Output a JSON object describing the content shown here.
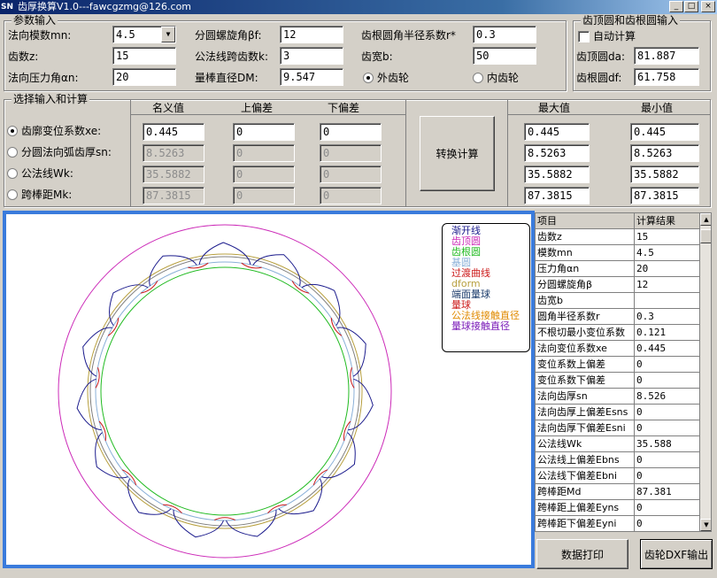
{
  "window": {
    "app_icon": "SN",
    "title": "齿厚换算V1.0---fawcgzmg@126.com",
    "minimize": "_",
    "maximize": "□",
    "close": "×"
  },
  "params": {
    "group_title": "参数输入",
    "mn_label": "法向模数mn:",
    "mn_value": "4.5",
    "z_label": "齿数z:",
    "z_value": "15",
    "an_label": "法向压力角αn:",
    "an_value": "20",
    "beta_label": "分圆螺旋角βf:",
    "beta_value": "12",
    "k_label": "公法线跨齿数k:",
    "k_value": "3",
    "dm_label": "量棒直径DM:",
    "dm_value": "9.547",
    "r_label": "齿根圆角半径系数r*",
    "r_value": "0.3",
    "b_label": "齿宽b:",
    "b_value": "50",
    "external_label": "外齿轮",
    "internal_label": "内齿轮",
    "gear_type": "external"
  },
  "tipbase": {
    "group_title": "齿顶圆和齿根圆输入",
    "auto_label": "自动计算",
    "auto_checked": false,
    "da_label": "齿顶圆da:",
    "da_value": "81.887",
    "df_label": "齿根圆df:",
    "df_value": "61.758"
  },
  "calc": {
    "group_title": "选择输入和计算",
    "col_nominal": "名义值",
    "col_upper": "上偏差",
    "col_lower": "下偏差",
    "col_max": "最大值",
    "col_min": "最小值",
    "button_label": "转换计算",
    "rows": [
      {
        "label": "齿廓变位系数xe:",
        "selected": true,
        "nominal": "0.445",
        "upper": "0",
        "lower": "0",
        "max": "0.445",
        "min": "0.445"
      },
      {
        "label": "分圆法向弧齿厚sn:",
        "selected": false,
        "nominal": "8.5263",
        "upper": "0",
        "lower": "0",
        "max": "8.5263",
        "min": "8.5263"
      },
      {
        "label": "公法线Wk:",
        "selected": false,
        "nominal": "35.5882",
        "upper": "0",
        "lower": "0",
        "max": "35.5882",
        "min": "35.5882"
      },
      {
        "label": "跨棒距Mk:",
        "selected": false,
        "nominal": "87.3815",
        "upper": "0",
        "lower": "0",
        "max": "87.3815",
        "min": "87.3815"
      }
    ]
  },
  "legend": [
    {
      "label": "渐开线",
      "color": "#1a1a8c"
    },
    {
      "label": "齿顶圆",
      "color": "#cc2ab8"
    },
    {
      "label": "齿根圆",
      "color": "#22bb22"
    },
    {
      "label": "基圆",
      "color": "#8ab0d8"
    },
    {
      "label": "过渡曲线",
      "color": "#cc1a1a"
    },
    {
      "label": "dform",
      "color": "#b8a040"
    },
    {
      "label": "端面量球",
      "color": "#1a3a6a"
    },
    {
      "label": "量球",
      "color": "#cc1a1a"
    },
    {
      "label": "公法线接触直径",
      "color": "#e08a00"
    },
    {
      "label": "量球接触直径",
      "color": "#7a1ab8"
    }
  ],
  "grid": {
    "header_item": "项目",
    "header_value": "计算结果",
    "rows": [
      {
        "k": "齿数z",
        "v": "15"
      },
      {
        "k": "模数mn",
        "v": "4.5"
      },
      {
        "k": "压力角αn",
        "v": "20"
      },
      {
        "k": "分圆螺旋角β",
        "v": "12"
      },
      {
        "k": "齿宽b",
        "v": ""
      },
      {
        "k": "圆角半径系数r",
        "v": "0.3"
      },
      {
        "k": "不根切最小变位系数",
        "v": "0.121"
      },
      {
        "k": "法向变位系数xe",
        "v": "0.445"
      },
      {
        "k": "变位系数上偏差",
        "v": "0"
      },
      {
        "k": "变位系数下偏差",
        "v": "0"
      },
      {
        "k": "法向齿厚sn",
        "v": "8.526"
      },
      {
        "k": "法向齿厚上偏差Esns",
        "v": "0"
      },
      {
        "k": "法向齿厚下偏差Esni",
        "v": "0"
      },
      {
        "k": "公法线Wk",
        "v": "35.588"
      },
      {
        "k": "公法线上偏差Ebns",
        "v": "0"
      },
      {
        "k": "公法线下偏差Ebni",
        "v": "0"
      },
      {
        "k": "跨棒距Md",
        "v": "87.381"
      },
      {
        "k": "跨棒距上偏差Eyns",
        "v": "0"
      },
      {
        "k": "跨棒距下偏差Eyni",
        "v": "0"
      }
    ]
  },
  "buttons": {
    "print": "数据打印",
    "dxf": "齿轮DXF输出"
  }
}
